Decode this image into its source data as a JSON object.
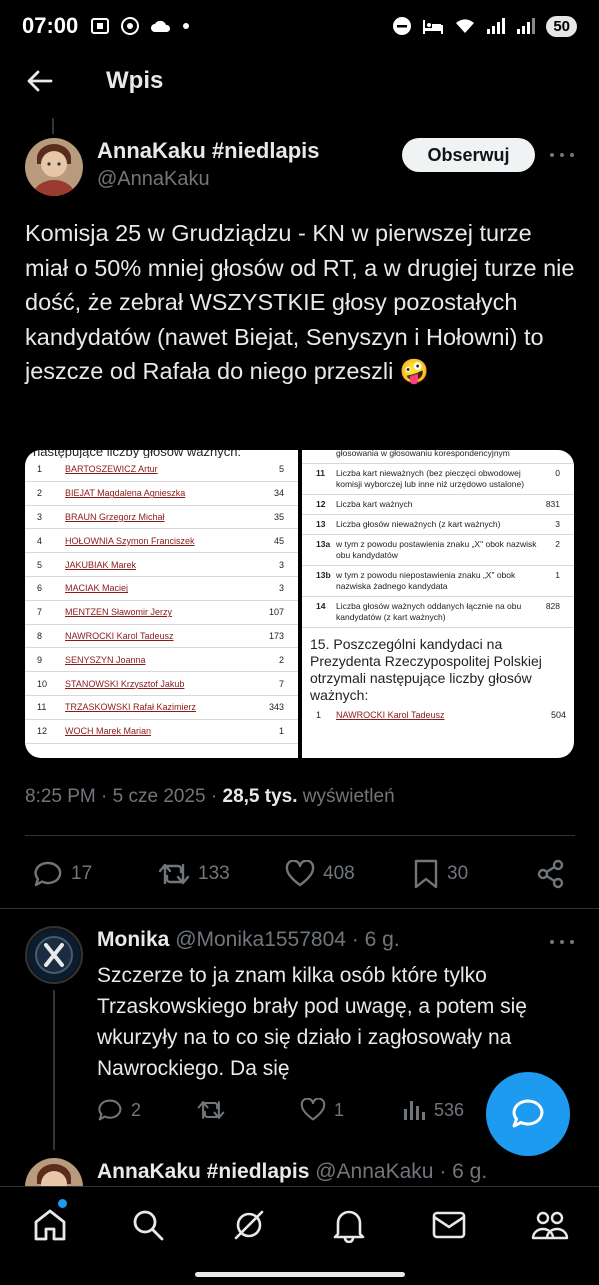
{
  "status_bar": {
    "time": "07:00",
    "battery": "50"
  },
  "header": {
    "title": "Wpis"
  },
  "tweet": {
    "author_name": "AnnaKaku #niedlapis",
    "author_handle": "@AnnaKaku",
    "follow_label": "Obserwuj",
    "text": "Komisja 25 w Grudziądzu - KN w pierwszej turze miał o 50% mniej głosów od RT, a w drugiej turze nie dość, że zebrał WSZYSTKIE głosy pozostałych kandydatów (nawet Biejat, Senyszyn i Hołowni) to jeszcze od Rafała do niego przeszli 🤪",
    "media_left": {
      "heading": "następujące liczby głosów ważnych:",
      "rows": [
        {
          "num": "1",
          "name": "BARTOSZEWICZ Artur",
          "votes": "5"
        },
        {
          "num": "2",
          "name": "BIEJAT Magdalena Agnieszka",
          "votes": "34"
        },
        {
          "num": "3",
          "name": "BRAUN Grzegorz Michał",
          "votes": "35"
        },
        {
          "num": "4",
          "name": "HOŁOWNIA Szymon Franciszek",
          "votes": "45"
        },
        {
          "num": "5",
          "name": "JAKUBIAK Marek",
          "votes": "3"
        },
        {
          "num": "6",
          "name": "MACIAK Maciej",
          "votes": "3"
        },
        {
          "num": "7",
          "name": "MENTZEN Sławomir Jerzy",
          "votes": "107"
        },
        {
          "num": "8",
          "name": "NAWROCKI Karol Tadeusz",
          "votes": "173"
        },
        {
          "num": "9",
          "name": "SENYSZYN Joanna",
          "votes": "2"
        },
        {
          "num": "10",
          "name": "STANOWSKI Krzysztof Jakub",
          "votes": "7"
        },
        {
          "num": "11",
          "name": "TRZASKOWSKI Rafał Kazimierz",
          "votes": "343"
        },
        {
          "num": "12",
          "name": "WOCH Marek Marian",
          "votes": "1"
        }
      ]
    },
    "media_right": {
      "top_fragment": "głosowania w głosowaniu korespondencyjnym",
      "rows": [
        {
          "key": "11",
          "desc": "Liczba kart nieważnych (bez pieczęci obwodowej komisji wyborczej lub inne niż urzędowo ustalone)",
          "val": "0"
        },
        {
          "key": "12",
          "desc": "Liczba kart ważnych",
          "val": "831"
        },
        {
          "key": "13",
          "desc": "Liczba głosów nieważnych (z kart ważnych)",
          "val": "3"
        },
        {
          "key": "13a",
          "desc": "w tym z powodu postawienia znaku „X\" obok nazwisk obu kandydatów",
          "val": "2"
        },
        {
          "key": "13b",
          "desc": "w tym z powodu niepostawienia znaku „X\" obok nazwiska żadnego kandydata",
          "val": "1"
        },
        {
          "key": "14",
          "desc": "Liczba głosów ważnych oddanych łącznie na obu kandydatów (z kart ważnych)",
          "val": "828"
        }
      ],
      "section15": "15. Poszczególni kandydaci na Prezydenta Rzeczypospolitej Polskiej otrzymali następujące liczby głosów ważnych:",
      "section15_row": {
        "num": "1",
        "name": "NAWROCKI Karol Tadeusz",
        "votes": "504"
      }
    },
    "time": "8:25 PM",
    "date": "5 cze 2025",
    "views_count": "28,5 tys.",
    "views_label": "wyświetleń",
    "replies": "17",
    "reposts": "133",
    "likes": "408",
    "bookmarks": "30"
  },
  "reply": {
    "author_name": "Monika",
    "author_handle": "@Monika1557804",
    "age": "6 g.",
    "text": "Szczerze to ja znam kilka osób które tylko Trzaskowskiego brały pod uwagę, a potem się wkurzyły na to co się działo i zagłosowały na Nawrockiego. Da się",
    "replies": "2",
    "likes": "1",
    "views": "536"
  },
  "next_reply": {
    "author_name": "AnnaKaku #niedlapis",
    "author_handle": "@AnnaKaku",
    "age": "6 g."
  },
  "icons": {
    "nav": [
      "home-icon",
      "search-icon",
      "grok-icon",
      "notifications-icon",
      "messages-icon",
      "communities-icon"
    ],
    "accent": "#1d9bf0"
  }
}
